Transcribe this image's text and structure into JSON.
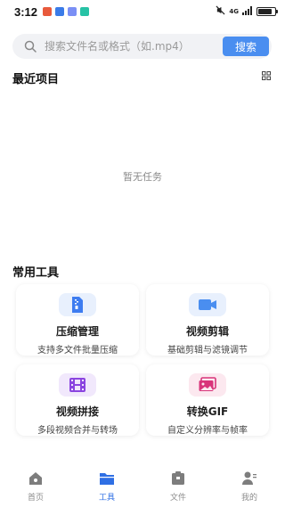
{
  "status_bar": {
    "time": "3:12",
    "signal_text": "4G",
    "battery_level": 0.85
  },
  "search": {
    "placeholder": "搜索文件名或格式（如.mp4）",
    "button_label": "搜索"
  },
  "recent": {
    "title": "最近项目",
    "empty_text": "暂无任务"
  },
  "tools": {
    "title": "常用工具",
    "items": [
      {
        "title": "压缩管理",
        "desc": "支持多文件批量压缩",
        "icon": "file-zip-icon",
        "color": "#3d7cf0",
        "bg": "#e8f0fd"
      },
      {
        "title": "视频剪辑",
        "desc": "基础剪辑与滤镜调节",
        "icon": "video-camera-icon",
        "color": "#4a8ef0",
        "bg": "#e8f0fd"
      },
      {
        "title": "视频拼接",
        "desc": "多段视频合并与转场",
        "icon": "film-icon",
        "color": "#8b45e0",
        "bg": "#f1e8fc"
      },
      {
        "title": "转换GIF",
        "desc": "自定义分辨率与帧率",
        "icon": "image-icon",
        "color": "#d8347a",
        "bg": "#fce8ef"
      }
    ]
  },
  "nav": {
    "items": [
      {
        "label": "首页",
        "icon": "home-icon"
      },
      {
        "label": "工具",
        "icon": "folder-icon",
        "active": true
      },
      {
        "label": "文件",
        "icon": "file-box-icon"
      },
      {
        "label": "我的",
        "icon": "user-icon"
      }
    ]
  }
}
